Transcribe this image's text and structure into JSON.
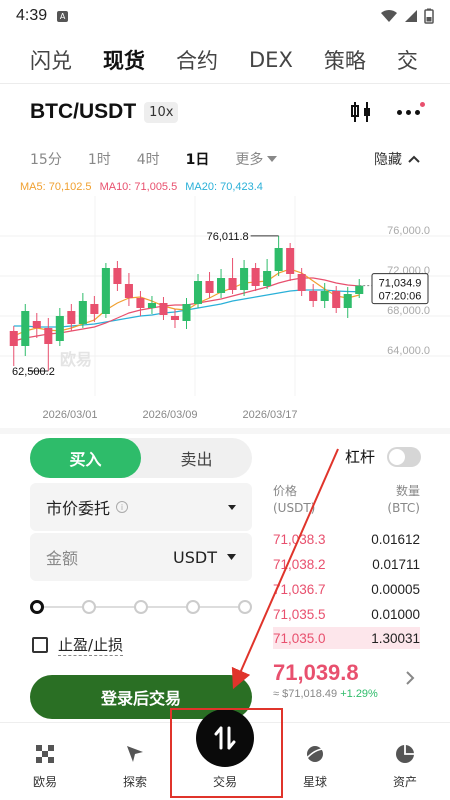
{
  "status_bar": {
    "time": "4:39",
    "sim_label": "A"
  },
  "top_tabs": [
    "闪兑",
    "现货",
    "合约",
    "DEX",
    "策略",
    "交"
  ],
  "top_tab_active_index": 1,
  "pair": {
    "name": "BTC/USDT",
    "leverage": "10x"
  },
  "periods": {
    "items": [
      "15分",
      "1时",
      "4时",
      "1日"
    ],
    "active": "1日",
    "more_label": "更多",
    "hide_label": "隐藏"
  },
  "ma": {
    "ma5": {
      "label": "MA5: 70,102.5",
      "color": "#f0a030"
    },
    "ma10": {
      "label": "MA10: 71,005.5",
      "color": "#e8506e"
    },
    "ma20": {
      "label": "MA20: 70,423.4",
      "color": "#2ab0d8"
    }
  },
  "chart_data": {
    "type": "candlestick",
    "y_ticks": [
      "76,000.0",
      "72,000.0",
      "68,000.0",
      "64,000.0"
    ],
    "ylim": [
      61000,
      79000
    ],
    "x_ticks": [
      "2026/03/01",
      "2026/03/09",
      "2026/03/17"
    ],
    "high_annotation": "76,011.8",
    "low_annotation": "62,500.2",
    "current_price_label": "71,034.9",
    "countdown_label": "07:20:06",
    "watermark": "欧易",
    "candles": [
      {
        "o": 66500,
        "c": 65000,
        "h": 67000,
        "l": 63000
      },
      {
        "o": 65000,
        "c": 68500,
        "h": 69200,
        "l": 64000
      },
      {
        "o": 67500,
        "c": 66800,
        "h": 68300,
        "l": 65800
      },
      {
        "o": 66800,
        "c": 65200,
        "h": 67800,
        "l": 62500
      },
      {
        "o": 65500,
        "c": 68000,
        "h": 68800,
        "l": 65000
      },
      {
        "o": 68500,
        "c": 67200,
        "h": 69200,
        "l": 66500
      },
      {
        "o": 67200,
        "c": 69500,
        "h": 70300,
        "l": 66800
      },
      {
        "o": 69200,
        "c": 68200,
        "h": 70000,
        "l": 67400
      },
      {
        "o": 68200,
        "c": 72800,
        "h": 73300,
        "l": 67800
      },
      {
        "o": 72800,
        "c": 71200,
        "h": 73500,
        "l": 70500
      },
      {
        "o": 71200,
        "c": 69800,
        "h": 72300,
        "l": 69000
      },
      {
        "o": 69800,
        "c": 68800,
        "h": 70500,
        "l": 68000
      },
      {
        "o": 68800,
        "c": 69300,
        "h": 70000,
        "l": 68200
      },
      {
        "o": 69300,
        "c": 68100,
        "h": 69900,
        "l": 67600
      },
      {
        "o": 68000,
        "c": 67600,
        "h": 68700,
        "l": 66800
      },
      {
        "o": 67500,
        "c": 69200,
        "h": 69800,
        "l": 66700
      },
      {
        "o": 69200,
        "c": 71500,
        "h": 72200,
        "l": 68800
      },
      {
        "o": 71500,
        "c": 70300,
        "h": 72400,
        "l": 69800
      },
      {
        "o": 70300,
        "c": 71800,
        "h": 72700,
        "l": 69800
      },
      {
        "o": 71800,
        "c": 70600,
        "h": 73800,
        "l": 70200
      },
      {
        "o": 70600,
        "c": 72800,
        "h": 73600,
        "l": 70000
      },
      {
        "o": 72800,
        "c": 71000,
        "h": 73300,
        "l": 70500
      },
      {
        "o": 71000,
        "c": 72500,
        "h": 73700,
        "l": 70700
      },
      {
        "o": 72500,
        "c": 74800,
        "h": 76011.8,
        "l": 72000
      },
      {
        "o": 74800,
        "c": 72200,
        "h": 75300,
        "l": 71500
      },
      {
        "o": 72200,
        "c": 70500,
        "h": 72800,
        "l": 70000
      },
      {
        "o": 70500,
        "c": 69500,
        "h": 71200,
        "l": 68900
      },
      {
        "o": 69500,
        "c": 70500,
        "h": 71300,
        "l": 68800
      },
      {
        "o": 70500,
        "c": 68800,
        "h": 71000,
        "l": 68300
      },
      {
        "o": 68800,
        "c": 70200,
        "h": 70900,
        "l": 67800
      },
      {
        "o": 70200,
        "c": 71034.9,
        "h": 71700,
        "l": 69800
      }
    ],
    "ma5": [
      66000,
      66500,
      66800,
      66600,
      66500,
      66800,
      67200,
      67600,
      68600,
      69300,
      69800,
      69900,
      69500,
      69000,
      68700,
      68600,
      69300,
      69800,
      70400,
      70800,
      71300,
      71400,
      71500,
      72300,
      72700,
      72300,
      71500,
      70700,
      70000,
      69800,
      70100
    ],
    "ma10": [
      65500,
      65800,
      66000,
      66200,
      66300,
      66500,
      66700,
      66900,
      67300,
      67800,
      68300,
      68600,
      68800,
      69000,
      69100,
      69100,
      69300,
      69500,
      69700,
      70000,
      70300,
      70600,
      70900,
      71300,
      71600,
      71800,
      71800,
      71600,
      71300,
      71100,
      71005.5
    ],
    "ma20": [
      67000,
      67000,
      66900,
      66900,
      66900,
      67000,
      67100,
      67200,
      67400,
      67600,
      67800,
      68000,
      68100,
      68300,
      68400,
      68600,
      68800,
      69000,
      69200,
      69500,
      69700,
      69900,
      70100,
      70300,
      70500,
      70600,
      70600,
      70600,
      70500,
      70450,
      70423.4
    ]
  },
  "order": {
    "buy_label": "买入",
    "sell_label": "卖出",
    "leverage_label": "杠杆",
    "order_type": "市价委托",
    "info_glyph": "i",
    "amount_placeholder": "金额",
    "amount_unit": "USDT",
    "tpsl_label": "止盈/止损",
    "login_button": "登录后交易"
  },
  "order_book": {
    "price_header": "价格",
    "price_unit": "(USDT)",
    "qty_header": "数量",
    "qty_unit": "(BTC)",
    "asks": [
      {
        "price": "71,038.3",
        "qty": "0.01612"
      },
      {
        "price": "71,038.2",
        "qty": "0.01711"
      },
      {
        "price": "71,036.7",
        "qty": "0.00005"
      },
      {
        "price": "71,035.5",
        "qty": "0.01000"
      },
      {
        "price": "71,035.0",
        "qty": "1.30031"
      }
    ],
    "ask_depth": [
      0.02,
      0.02,
      0.01,
      0.02,
      0.99
    ],
    "last_price": "71,039.8",
    "last_sub_usd": "≈ $71,018.49",
    "last_sub_change": "+1.29%"
  },
  "bottom_nav": [
    "欧易",
    "探索",
    "交易",
    "星球",
    "资产"
  ],
  "annotation": {
    "color": "#e0342b"
  }
}
